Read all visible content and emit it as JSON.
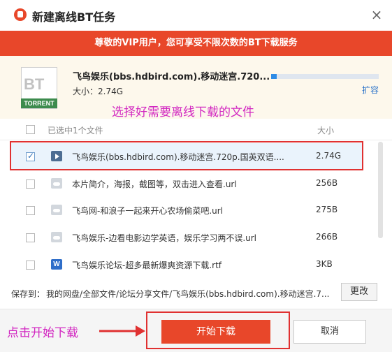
{
  "window": {
    "title": "新建离线BT任务"
  },
  "banner": {
    "text": "尊敬的VIP用户，您可享受不限次数的BT下载服务"
  },
  "torrent": {
    "icon_label": "BT",
    "icon_badge": "TORRENT",
    "name": "飞鸟娱乐(bbs.hdbird.com).移动迷宫.720...",
    "size_text": "大小：2.74G",
    "expand_label": "扩容",
    "progress_fraction": 0.05
  },
  "annotations": {
    "select_hint": "选择好需要离线下载的文件",
    "start_hint": "点击开始下载"
  },
  "list": {
    "selected_count_label": "已选中1个文件",
    "size_header": "大小",
    "rows": [
      {
        "name": "飞鸟娱乐(bbs.hdbird.com).移动迷宫.720p.国英双语....",
        "size": "2.74G",
        "checked": true,
        "icon": "video-icon"
      },
      {
        "name": "本片简介，海报，截图等，双击进入查看.url",
        "size": "256B",
        "checked": false,
        "icon": "cloud-icon"
      },
      {
        "name": "飞鸟网-和浪子一起来开心农场偷菜吧.url",
        "size": "275B",
        "checked": false,
        "icon": "cloud-icon"
      },
      {
        "name": "飞鸟娱乐-边看电影边学英语，娱乐学习两不误.url",
        "size": "266B",
        "checked": false,
        "icon": "cloud-icon"
      },
      {
        "name": "飞鸟娱乐论坛-超多最新爆爽资源下载.rtf",
        "size": "3KB",
        "checked": false,
        "icon": "word-icon",
        "icon_letter": "W"
      }
    ]
  },
  "save": {
    "label": "保存到：",
    "path": "我的网盘/全部文件/论坛分享文件/飞鸟娱乐(bbs.hdbird.com).移动迷宫.7...",
    "change_label": "更改"
  },
  "footer": {
    "start_label": "开始下载",
    "cancel_label": "取消"
  },
  "colors": {
    "accent": "#e8472a",
    "annotation": "#d227c1",
    "highlight": "#e03131",
    "link": "#2e75c9"
  }
}
